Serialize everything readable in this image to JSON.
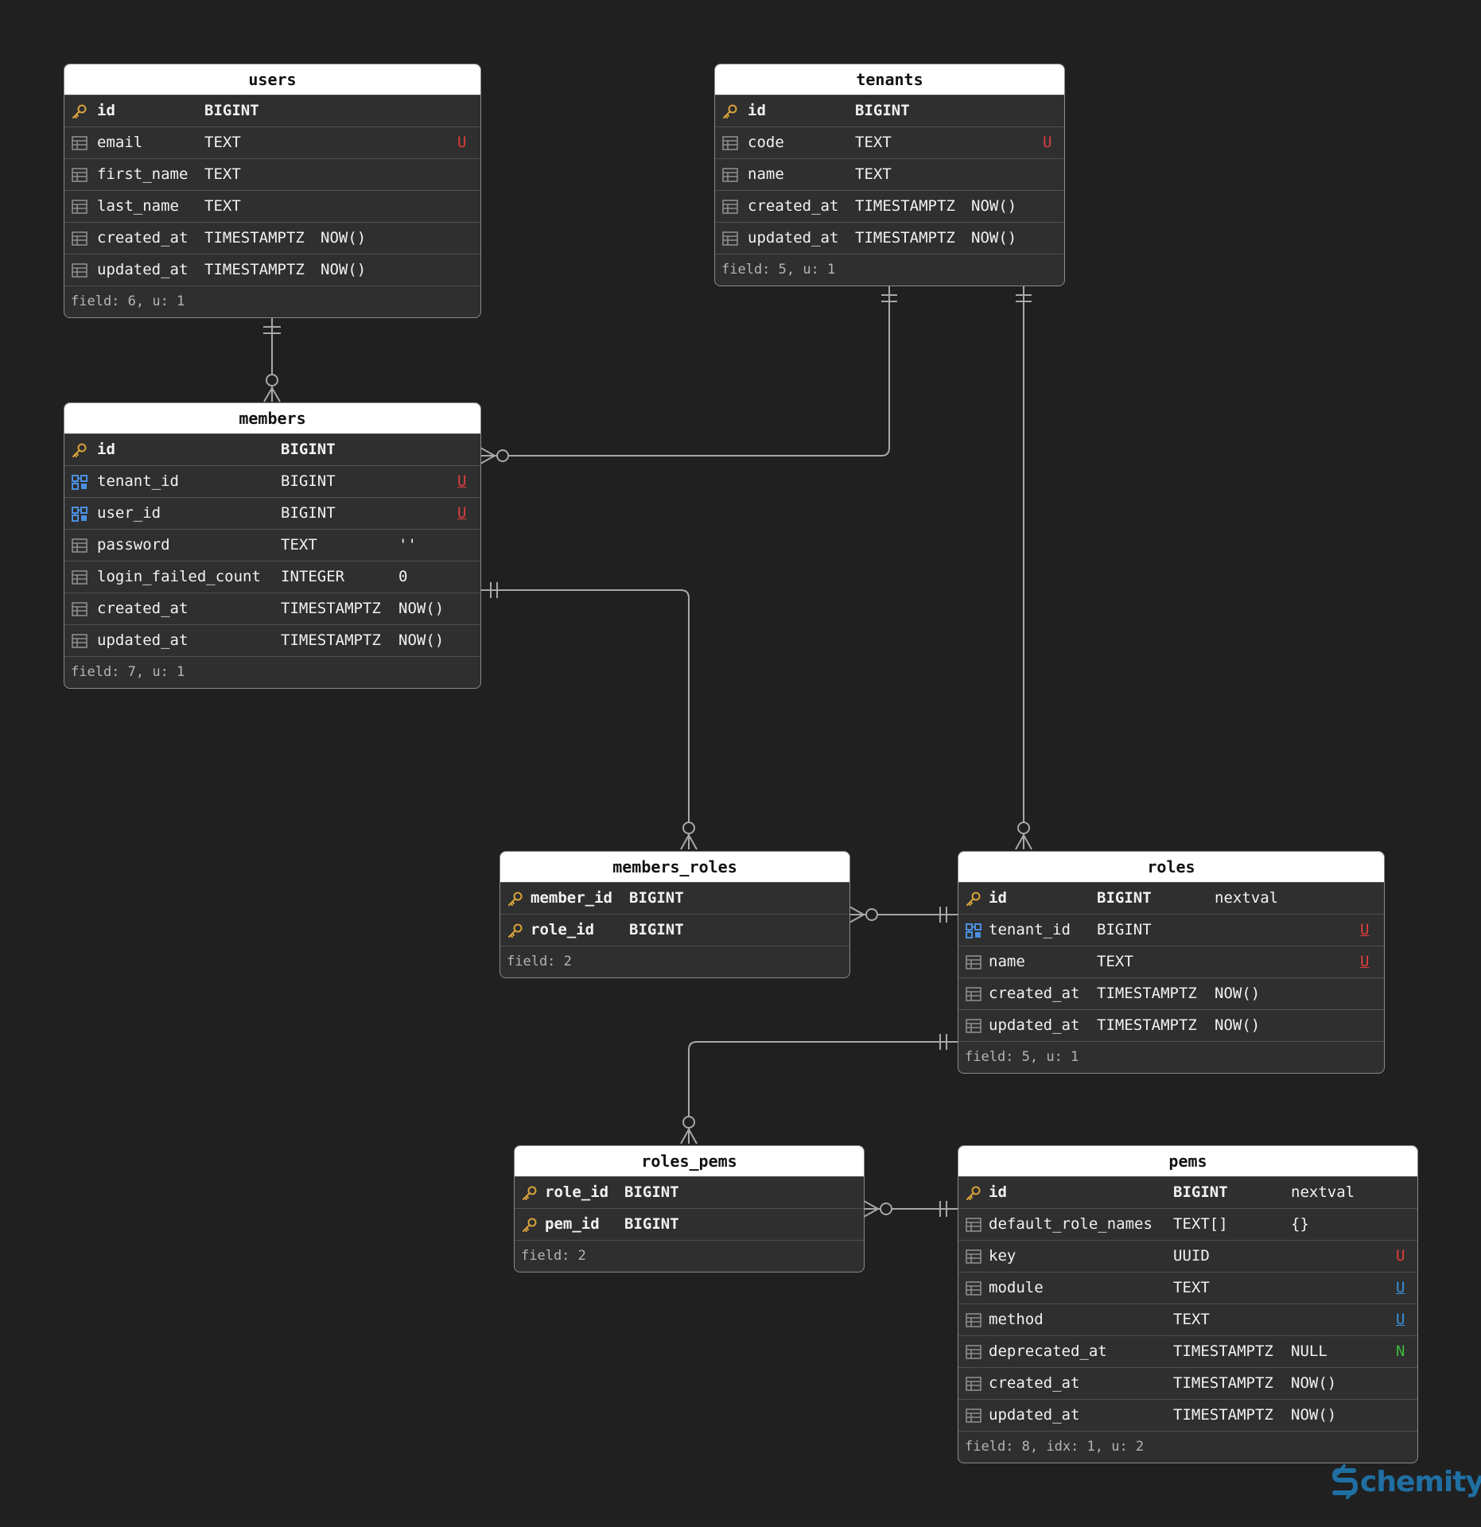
{
  "logo": {
    "text": "chemity",
    "color": "#1f6fa3"
  },
  "colors": {
    "background": "#202020",
    "primary_key_icon": "#d9a33a",
    "foreign_key_icon": "#4a8fe0",
    "unique_red": "#e03c3c",
    "unique_blue": "#3a8fd9",
    "nullable_green": "#3cb83c"
  },
  "tables": {
    "users": {
      "name": "users",
      "rows": [
        {
          "icon": "key-icon",
          "name": "id",
          "type": "BIGINT",
          "default": "",
          "flag": "",
          "pk": true
        },
        {
          "icon": "column-icon",
          "name": "email",
          "type": "TEXT",
          "default": "",
          "flag": "U"
        },
        {
          "icon": "column-icon",
          "name": "first_name",
          "type": "TEXT",
          "default": "",
          "flag": ""
        },
        {
          "icon": "column-icon",
          "name": "last_name",
          "type": "TEXT",
          "default": "",
          "flag": ""
        },
        {
          "icon": "column-icon",
          "name": "created_at",
          "type": "TIMESTAMPTZ",
          "default": "NOW()",
          "flag": ""
        },
        {
          "icon": "column-icon",
          "name": "updated_at",
          "type": "TIMESTAMPTZ",
          "default": "NOW()",
          "flag": ""
        }
      ],
      "footer": "field: 6, u: 1"
    },
    "tenants": {
      "name": "tenants",
      "rows": [
        {
          "icon": "key-icon",
          "name": "id",
          "type": "BIGINT",
          "default": "",
          "flag": "",
          "pk": true
        },
        {
          "icon": "column-icon",
          "name": "code",
          "type": "TEXT",
          "default": "",
          "flag": "U"
        },
        {
          "icon": "column-icon",
          "name": "name",
          "type": "TEXT",
          "default": "",
          "flag": ""
        },
        {
          "icon": "column-icon",
          "name": "created_at",
          "type": "TIMESTAMPTZ",
          "default": "NOW()",
          "flag": ""
        },
        {
          "icon": "column-icon",
          "name": "updated_at",
          "type": "TIMESTAMPTZ",
          "default": "NOW()",
          "flag": ""
        }
      ],
      "footer": "field: 5, u: 1"
    },
    "members": {
      "name": "members",
      "rows": [
        {
          "icon": "key-icon",
          "name": "id",
          "type": "BIGINT",
          "default": "",
          "flag": "",
          "pk": true
        },
        {
          "icon": "foreign-key-icon",
          "name": "tenant_id",
          "type": "BIGINT",
          "default": "",
          "flag": "U",
          "flag_underline": true
        },
        {
          "icon": "foreign-key-icon",
          "name": "user_id",
          "type": "BIGINT",
          "default": "",
          "flag": "U",
          "flag_underline": true
        },
        {
          "icon": "column-icon",
          "name": "password",
          "type": "TEXT",
          "default": "''",
          "flag": ""
        },
        {
          "icon": "column-icon",
          "name": "login_failed_count",
          "type": "INTEGER",
          "default": "0",
          "flag": ""
        },
        {
          "icon": "column-icon",
          "name": "created_at",
          "type": "TIMESTAMPTZ",
          "default": "NOW()",
          "flag": ""
        },
        {
          "icon": "column-icon",
          "name": "updated_at",
          "type": "TIMESTAMPTZ",
          "default": "NOW()",
          "flag": ""
        }
      ],
      "footer": "field: 7, u: 1"
    },
    "members_roles": {
      "name": "members_roles",
      "rows": [
        {
          "icon": "key-icon",
          "name": "member_id",
          "type": "BIGINT",
          "default": "",
          "flag": "",
          "pk": true
        },
        {
          "icon": "key-icon",
          "name": "role_id",
          "type": "BIGINT",
          "default": "",
          "flag": "",
          "pk": true
        }
      ],
      "footer": "field: 2"
    },
    "roles": {
      "name": "roles",
      "rows": [
        {
          "icon": "key-icon",
          "name": "id",
          "type": "BIGINT",
          "default": "nextval",
          "flag": "",
          "pk": true
        },
        {
          "icon": "foreign-key-icon",
          "name": "tenant_id",
          "type": "BIGINT",
          "default": "",
          "flag": "U",
          "flag_underline": true
        },
        {
          "icon": "column-icon",
          "name": "name",
          "type": "TEXT",
          "default": "",
          "flag": "U",
          "flag_underline": true
        },
        {
          "icon": "column-icon",
          "name": "created_at",
          "type": "TIMESTAMPTZ",
          "default": "NOW()",
          "flag": ""
        },
        {
          "icon": "column-icon",
          "name": "updated_at",
          "type": "TIMESTAMPTZ",
          "default": "NOW()",
          "flag": ""
        }
      ],
      "footer": "field: 5, u: 1"
    },
    "roles_pems": {
      "name": "roles_pems",
      "rows": [
        {
          "icon": "key-icon",
          "name": "role_id",
          "type": "BIGINT",
          "default": "",
          "flag": "",
          "pk": true
        },
        {
          "icon": "key-icon",
          "name": "pem_id",
          "type": "BIGINT",
          "default": "",
          "flag": "",
          "pk": true
        }
      ],
      "footer": "field: 2"
    },
    "pems": {
      "name": "pems",
      "rows": [
        {
          "icon": "key-icon",
          "name": "id",
          "type": "BIGINT",
          "default": "nextval",
          "flag": "",
          "pk": true
        },
        {
          "icon": "column-icon",
          "name": "default_role_names",
          "type": "TEXT[]",
          "default": "{}",
          "flag": ""
        },
        {
          "icon": "column-icon",
          "name": "key",
          "type": "UUID",
          "default": "",
          "flag": "U"
        },
        {
          "icon": "column-icon",
          "name": "module",
          "type": "TEXT",
          "default": "",
          "flag": "U",
          "flag_underline": true,
          "flag_color": "blue"
        },
        {
          "icon": "column-icon",
          "name": "method",
          "type": "TEXT",
          "default": "",
          "flag": "U",
          "flag_underline": true,
          "flag_color": "blue"
        },
        {
          "icon": "column-icon",
          "name": "deprecated_at",
          "type": "TIMESTAMPTZ",
          "default": "NULL",
          "flag": "N",
          "flag_color": "green"
        },
        {
          "icon": "column-icon",
          "name": "created_at",
          "type": "TIMESTAMPTZ",
          "default": "NOW()",
          "flag": ""
        },
        {
          "icon": "column-icon",
          "name": "updated_at",
          "type": "TIMESTAMPTZ",
          "default": "NOW()",
          "flag": ""
        }
      ],
      "footer": "field: 8, idx: 1, u: 2"
    }
  },
  "relationships": [
    {
      "from": "users.id",
      "to": "members.user_id",
      "from_card": "one",
      "to_card": "zero-or-many"
    },
    {
      "from": "tenants.id",
      "to": "members.tenant_id",
      "from_card": "one",
      "to_card": "zero-or-many"
    },
    {
      "from": "tenants.id",
      "to": "roles.tenant_id",
      "from_card": "one",
      "to_card": "zero-or-many"
    },
    {
      "from": "members.id",
      "to": "members_roles.member_id",
      "from_card": "one",
      "to_card": "zero-or-many"
    },
    {
      "from": "roles.id",
      "to": "members_roles.role_id",
      "from_card": "one",
      "to_card": "zero-or-many"
    },
    {
      "from": "roles.id",
      "to": "roles_pems.role_id",
      "from_card": "one",
      "to_card": "zero-or-many"
    },
    {
      "from": "pems.id",
      "to": "roles_pems.pem_id",
      "from_card": "one",
      "to_card": "zero-or-many"
    }
  ]
}
